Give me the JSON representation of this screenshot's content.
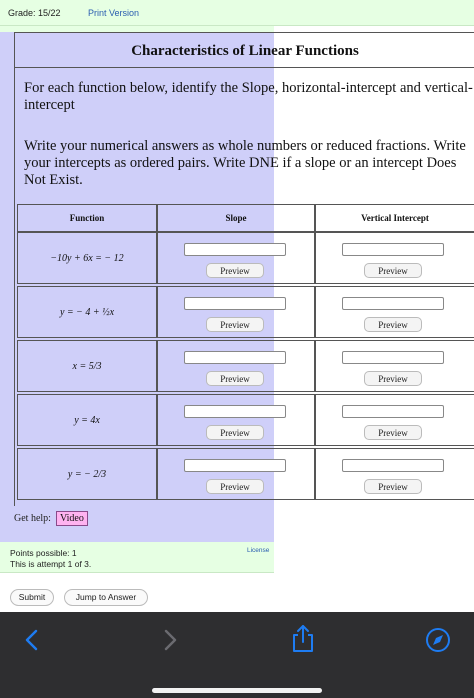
{
  "header": {
    "grade": "Grade: 15/22",
    "print_version": "Print Version"
  },
  "question": {
    "title": "Characteristics of Linear Functions",
    "instruction1": "For each function below, identify the Slope, horizontal-intercept and vertical-intercept",
    "instruction2": "Write your numerical answers as whole numbers or reduced fractions. Write your intercepts as ordered pairs. Write DNE if a slope or an intercept Does Not Exist.",
    "columns": [
      "Function",
      "Slope",
      "Vertical Intercept"
    ],
    "preview_label": "Preview",
    "rows": [
      {
        "function": "−10y + 6x = − 12",
        "slope": "",
        "vertical_intercept": ""
      },
      {
        "function": "y = − 4 + ½x",
        "slope": "",
        "vertical_intercept": ""
      },
      {
        "function": "x = 5/3",
        "slope": "",
        "vertical_intercept": ""
      },
      {
        "function": "y = 4x",
        "slope": "",
        "vertical_intercept": ""
      },
      {
        "function": "y = − 2/3",
        "slope": "",
        "vertical_intercept": ""
      }
    ]
  },
  "help": {
    "label": "Get help:",
    "video": "Video"
  },
  "status": {
    "points": "Points possible: 1",
    "attempt": "This is attempt 1 of 3.",
    "license": "License"
  },
  "actions": {
    "submit": "Submit",
    "jump": "Jump to Answer"
  },
  "browser_nav": {
    "back": "back-icon",
    "forward": "forward-icon",
    "share": "share-icon",
    "compass": "compass-icon"
  },
  "colors": {
    "highlight_blue": "#cfcff9",
    "highlight_green": "#e6ffe3",
    "video_bg": "#ffb3f0",
    "link": "#2a5db0",
    "nav_accent": "#1e7cf2"
  }
}
